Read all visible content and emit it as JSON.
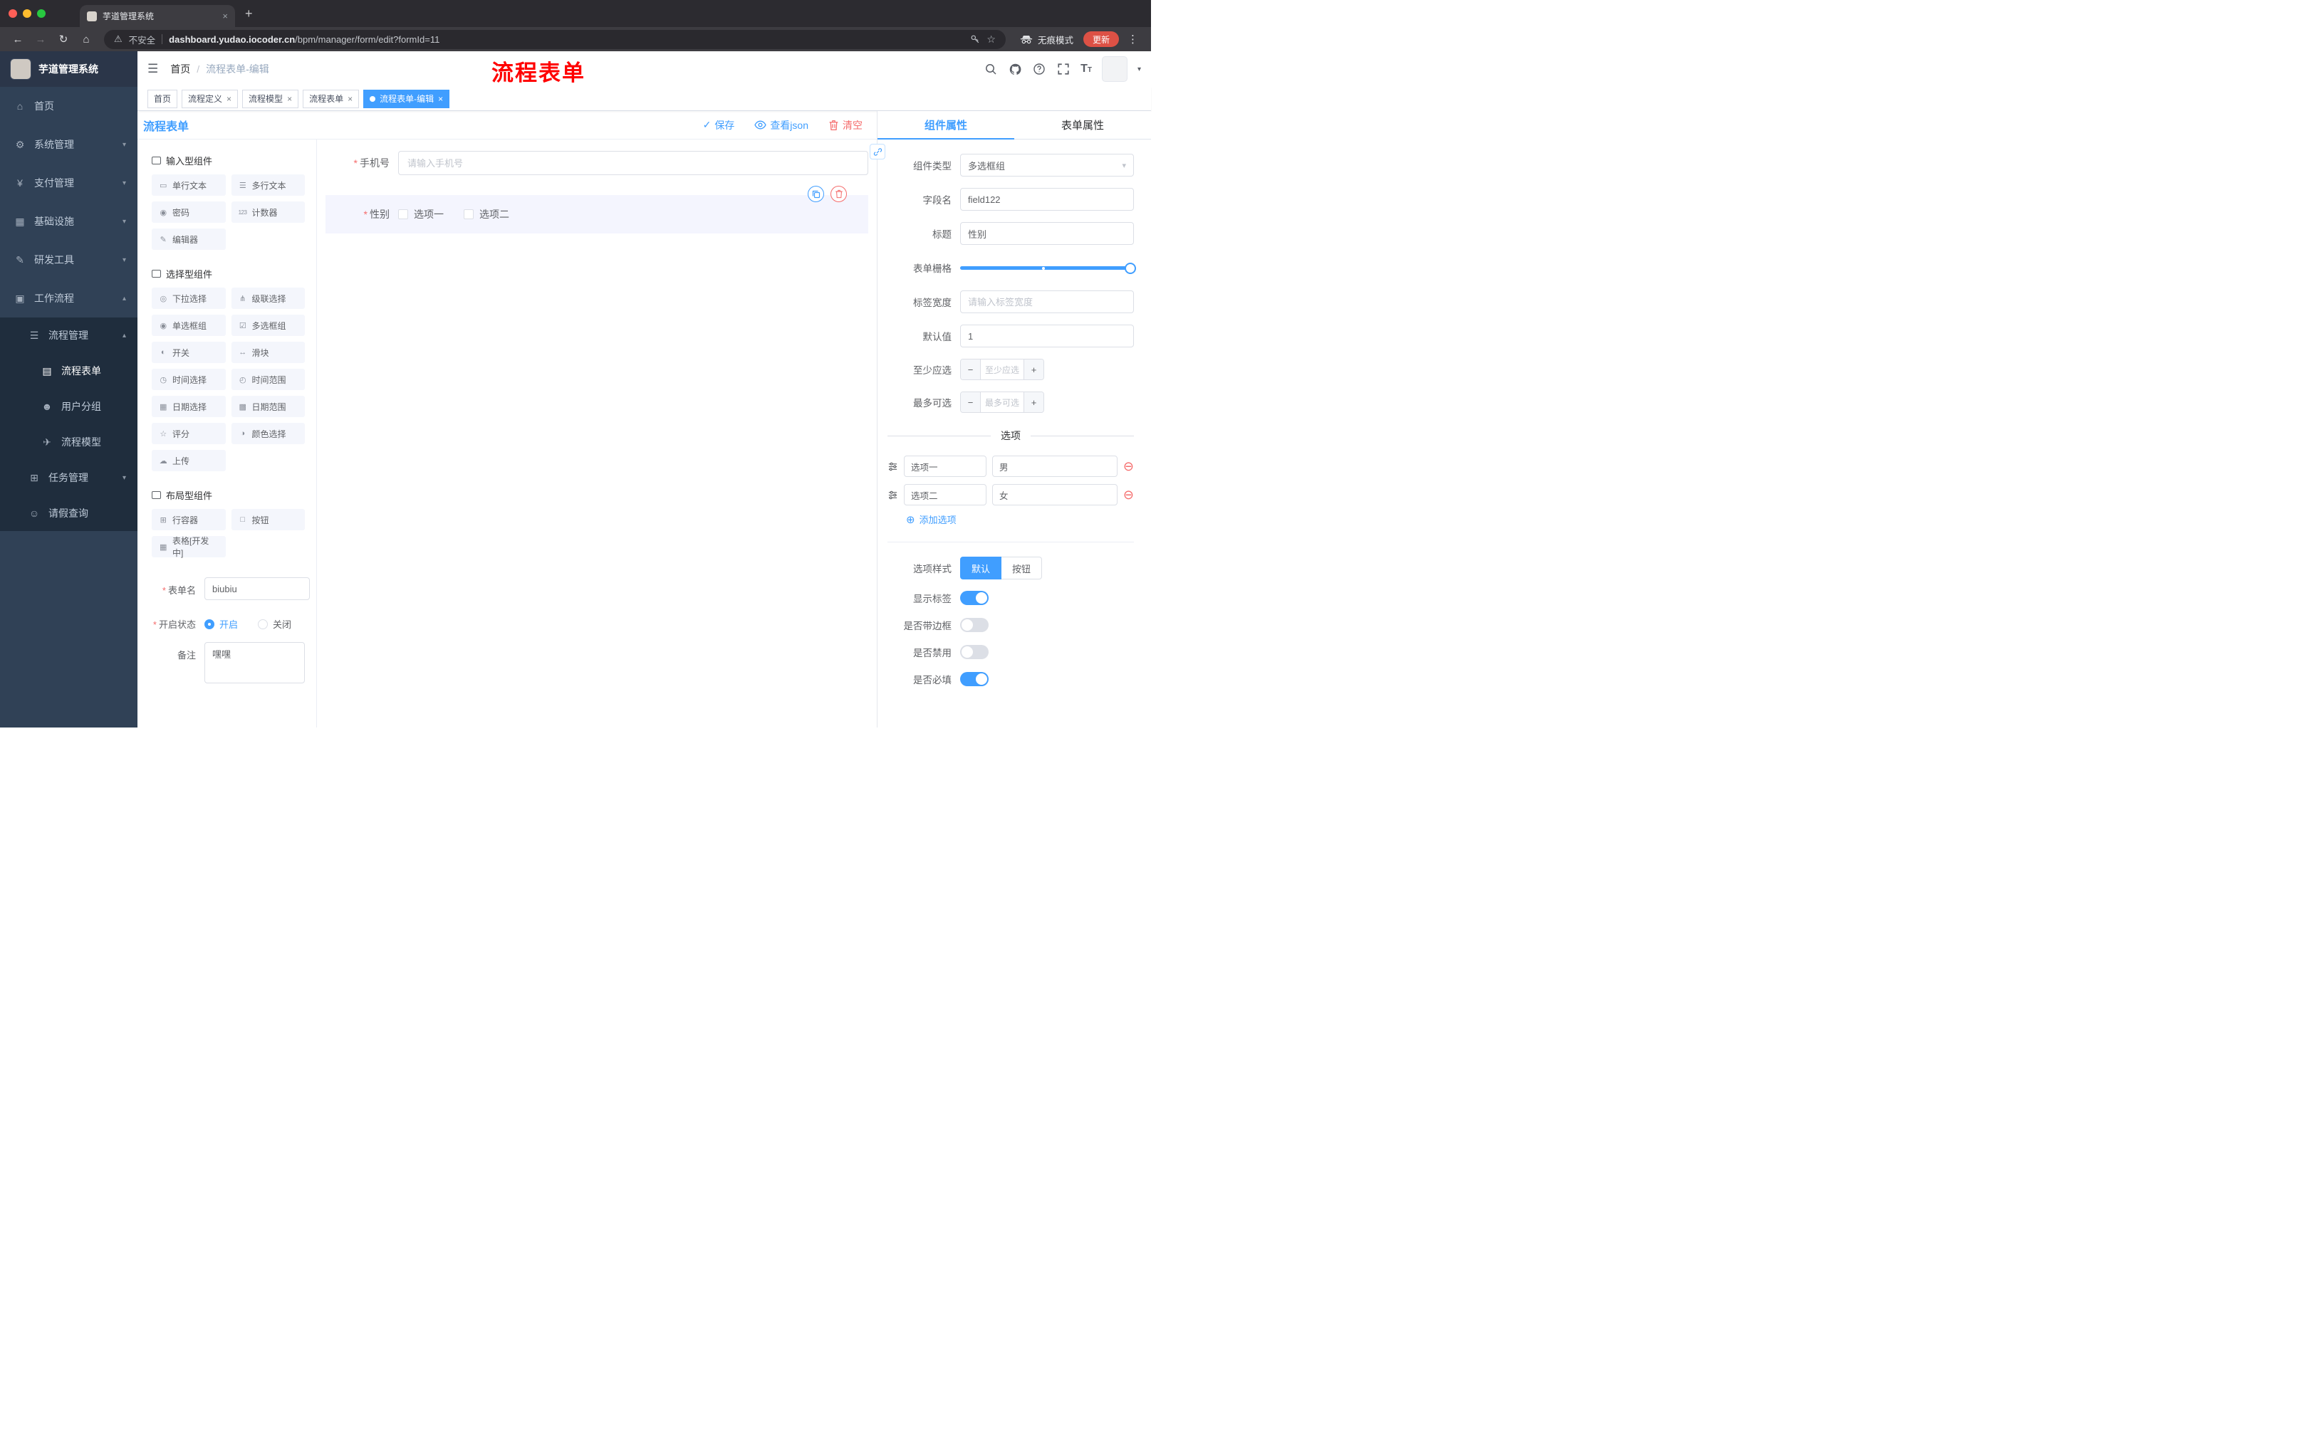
{
  "colors": {
    "accent": "#409eff",
    "danger": "#f56c6c",
    "annotation": "#ff0000",
    "sidebar_bg": "#304156"
  },
  "icons": {
    "close": "×",
    "plus": "+",
    "back": "←",
    "forward": "→",
    "reload": "↻",
    "home": "⌂",
    "warning": "⚠",
    "star": "☆",
    "kebab": "⋮",
    "hamburger": "☰",
    "slash": "/",
    "chevron_down": "▾",
    "chevron_up": "▴",
    "check": "✓",
    "add_circle": "⊕",
    "remove_circle": "⊖",
    "required_mark": "*",
    "minus": "−",
    "caret": "▾"
  },
  "browser": {
    "tab_title": "芋道管理系统",
    "security_label": "不安全",
    "url_domain": "dashboard.yudao.iocoder.cn",
    "url_path": "/bpm/manager/form/edit?formId=11",
    "incognito_label": "无痕模式",
    "update_label": "更新"
  },
  "sidebar": {
    "logo_title": "芋道管理系统",
    "items": {
      "home": "首页",
      "system": "系统管理",
      "payment": "支付管理",
      "infra": "基础设施",
      "devtools": "研发工具",
      "workflow": "工作流程",
      "process_mgmt": "流程管理",
      "process_form": "流程表单",
      "user_group": "用户分组",
      "process_model": "流程模型",
      "task_mgmt": "任务管理",
      "leave_query": "请假查询"
    },
    "icons": {
      "home": "⌂",
      "system": "⚙",
      "payment": "¥",
      "infra": "▦",
      "devtools": "✎",
      "workflow": "▣",
      "process_mgmt": "☰",
      "process_form": "▤",
      "user_group": "☻",
      "process_model": "✈",
      "task_mgmt": "⊞",
      "leave_query": "☺"
    }
  },
  "header": {
    "breadcrumb_home": "首页",
    "breadcrumb_current": "流程表单-编辑",
    "annotation": "流程表单"
  },
  "tags": [
    {
      "label": "首页"
    },
    {
      "label": "流程定义"
    },
    {
      "label": "流程模型"
    },
    {
      "label": "流程表单"
    },
    {
      "label": "流程表单-编辑"
    }
  ],
  "designer": {
    "title": "流程表单",
    "save": "保存",
    "view_json": "查看json",
    "clear": "清空"
  },
  "palette": {
    "group1_title": "输入型组件",
    "group1": [
      "单行文本",
      "多行文本",
      "密码",
      "计数器",
      "编辑器"
    ],
    "group1_icons": [
      "▭",
      "☰",
      "◉",
      "123",
      "✎"
    ],
    "group2_title": "选择型组件",
    "group2": [
      "下拉选择",
      "级联选择",
      "单选框组",
      "多选框组",
      "开关",
      "滑块",
      "时间选择",
      "时间范围",
      "日期选择",
      "日期范围",
      "评分",
      "颜色选择",
      "上传"
    ],
    "group2_icons": [
      "◎",
      "⋔",
      "◉",
      "☑",
      "◐",
      "↔",
      "◷",
      "◴",
      "▦",
      "▩",
      "☆",
      "◑",
      "☁"
    ],
    "group3_title": "布局型组件",
    "group3": [
      "行容器",
      "按钮",
      "表格[开发中]"
    ],
    "group3_icons": [
      "⊞",
      "□",
      "▦"
    ]
  },
  "form_meta": {
    "name_label": "表单名",
    "name_value": "biubiu",
    "status_label": "开启状态",
    "status_on": "开启",
    "status_off": "关闭",
    "remark_label": "备注",
    "remark_value": "嘿嘿"
  },
  "canvas": {
    "phone_label": "手机号",
    "phone_placeholder": "请输入手机号",
    "gender_label": "性别",
    "gender_opt1": "选项一",
    "gender_opt2": "选项二"
  },
  "props": {
    "tab_component": "组件属性",
    "tab_form": "表单属性",
    "component_type_label": "组件类型",
    "component_type_value": "多选框组",
    "field_name_label": "字段名",
    "field_name_value": "field122",
    "title_label": "标题",
    "title_value": "性别",
    "grid_label": "表单栅格",
    "label_width_label": "标签宽度",
    "label_width_placeholder": "请输入标签宽度",
    "default_label": "默认值",
    "default_value": "1",
    "min_label": "至少应选",
    "min_placeholder": "至少应选",
    "max_label": "最多可选",
    "max_placeholder": "最多可选",
    "options_title": "选项",
    "option1_name": "选项一",
    "option1_value": "男",
    "option2_name": "选项二",
    "option2_value": "女",
    "add_option": "添加选项",
    "style_label": "选项样式",
    "style_default": "默认",
    "style_button": "按钮",
    "show_label_label": "显示标签",
    "border_label": "是否带边框",
    "disabled_label": "是否禁用",
    "required_label": "是否必填"
  }
}
